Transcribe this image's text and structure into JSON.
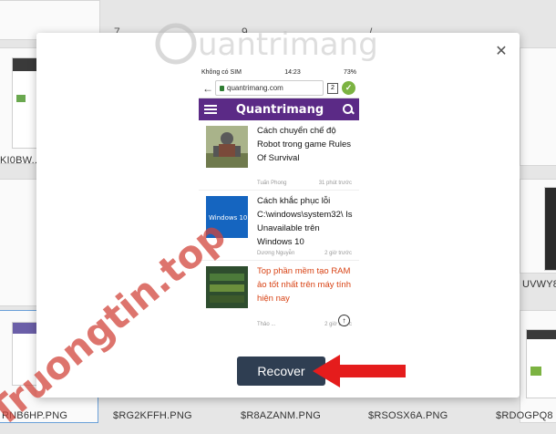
{
  "background": {
    "top_row_numbers": [
      "7",
      "9",
      "/"
    ],
    "filenames": {
      "left_mid": "KI0BW...",
      "right_mid": "UVWY8",
      "bottom": [
        "RNB6HP.PNG",
        "$RG2KFFH.PNG",
        "$R8AZANM.PNG",
        "$RSOSX6A.PNG",
        "$RDOGPQ8"
      ]
    }
  },
  "modal": {
    "close_label": "✕",
    "phone": {
      "status_left": "Không có SIM",
      "status_time": "14:23",
      "status_right": "73%",
      "url": "quantrimang.com",
      "tab_count": "2",
      "site_logo": "Quantrimang",
      "articles": [
        {
          "title": "Cách chuyển chế độ Robot trong game Rules Of Survival",
          "author": "Tuấn Phong",
          "time": "31 phút trước",
          "highlight": false
        },
        {
          "title": "Cách khắc phục lỗi C:\\windows\\system32\\ Is Unavailable trên Windows 10",
          "author": "Dương Nguyễn",
          "time": "2 giờ trước",
          "highlight": false,
          "image_text": "Windows 10"
        },
        {
          "title": "Top phần mềm tạo RAM ảo tốt nhất trên máy tính hiện nay",
          "author": "Thảo ...",
          "time": "2 giờ trước",
          "highlight": true
        }
      ]
    },
    "recover_label": "Recover"
  },
  "watermarks": {
    "top": "Quantrimang",
    "side": "Truongtin.top"
  },
  "colors": {
    "site_purple": "#5b2a86",
    "recover_bg": "#2f3e52",
    "arrow_red": "#e51c1c"
  }
}
